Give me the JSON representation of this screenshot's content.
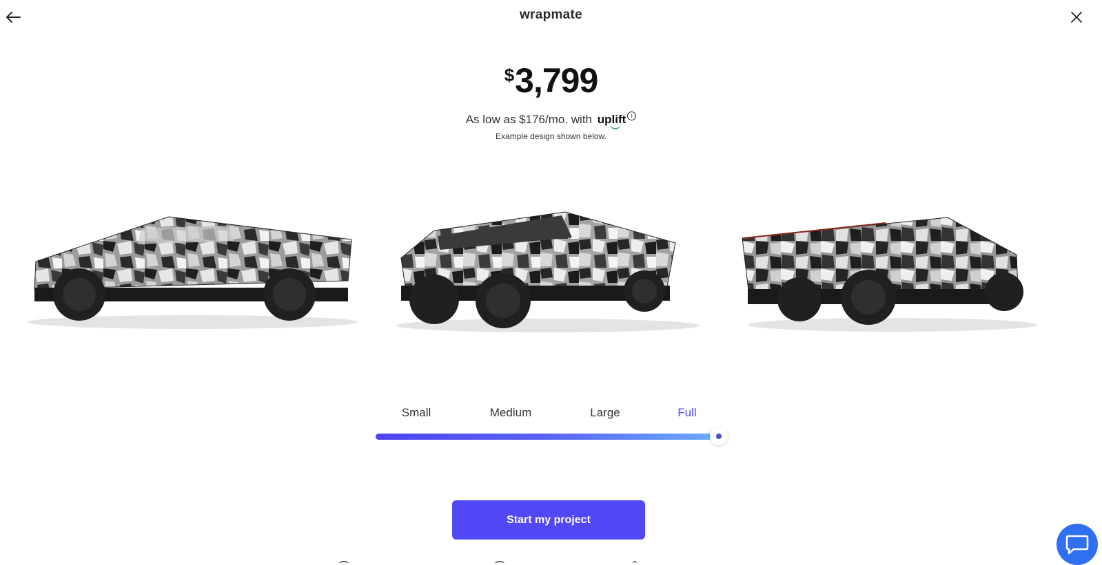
{
  "header": {
    "logo": "wrapmate",
    "back_icon": "arrow-left-icon",
    "close_icon": "close-icon"
  },
  "pricing": {
    "currency": "$",
    "amount": "3,799",
    "financing_prefix": "As low as $176/mo. with",
    "financing_brand": "uplift",
    "info_icon_glyph": "i",
    "note": "Example design shown below."
  },
  "truck_views": [
    "side-view",
    "front-three-quarter-view",
    "rear-three-quarter-view"
  ],
  "coverage": {
    "options": [
      "Small",
      "Medium",
      "Large",
      "Full"
    ],
    "selected": "Full",
    "slider_level": 1.0,
    "track_gradient": [
      "#4d44f2",
      "#6aaefc"
    ]
  },
  "cta": {
    "label": "Start my project",
    "color": "#5147f5"
  },
  "chat": {
    "icon": "chat-bubble-icon",
    "color": "#2f6ff2"
  },
  "accent_color": "#5147f0"
}
